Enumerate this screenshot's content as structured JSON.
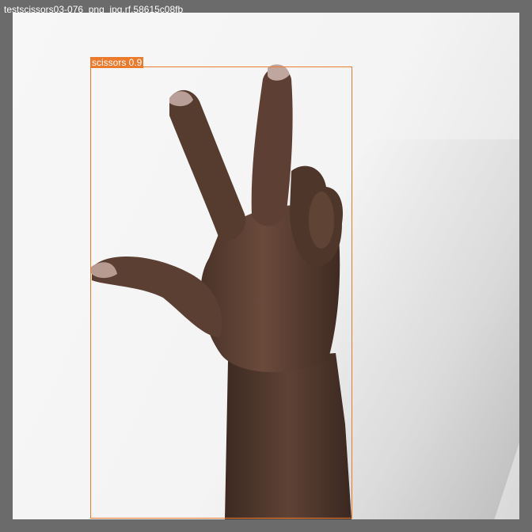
{
  "image": {
    "filename": "testscissors03-076_png_jpg.rf.58615c08fb"
  },
  "detection": {
    "label": "scissors 0.9",
    "box_color": "#ec7a2c"
  },
  "colors": {
    "background": "#6b6b6b",
    "photo": "#f4f4f4",
    "skin": "#5a3f33"
  }
}
